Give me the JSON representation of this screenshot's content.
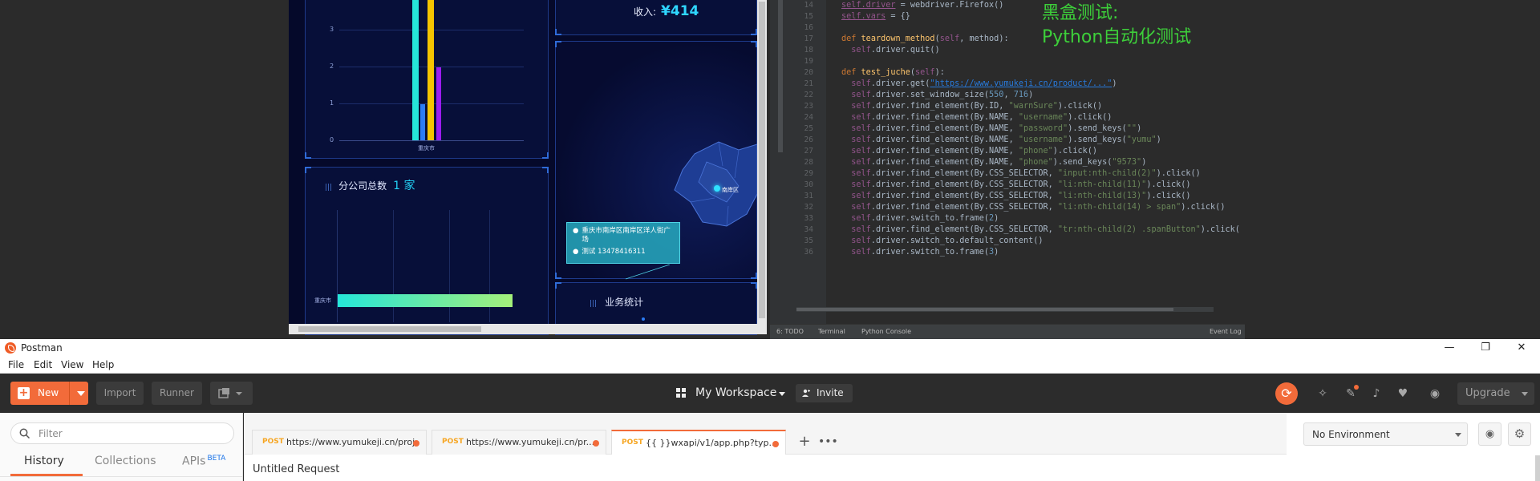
{
  "dashboard": {
    "y_ticks": [
      "3",
      "2",
      "1",
      "0"
    ],
    "x_label": "重庆市",
    "branch_title": "分公司总数",
    "branch_count": "1 家",
    "branch_bar_label": "重庆市",
    "income_label": "收入:",
    "income_value": "¥414",
    "map_marker": "南岸区",
    "tooltip_address": "重庆市南岸区南岸区洋人街广场",
    "tooltip_contact": "测试 13478416311",
    "business_title": "业务统计",
    "colors": {
      "cyan": "#25e6d9",
      "yellow": "#f5c400",
      "blue": "#2b7cf6",
      "purple": "#9b1cf0"
    }
  },
  "editor": {
    "lines": [
      {
        "n": "14",
        "code": [
          {
            "c": "selfu",
            "t": "self.driver"
          },
          {
            "c": "plain",
            "t": " = webdriver.Firefox()"
          }
        ]
      },
      {
        "n": "15",
        "code": [
          {
            "c": "selfu",
            "t": "self.vars"
          },
          {
            "c": "plain",
            "t": " = {}"
          }
        ]
      },
      {
        "n": "16",
        "code": []
      },
      {
        "n": "17",
        "code": [
          {
            "c": "kw",
            "t": "def "
          },
          {
            "c": "fn",
            "t": "teardown_method"
          },
          {
            "c": "plain",
            "t": "("
          },
          {
            "c": "self",
            "t": "self"
          },
          {
            "c": "plain",
            "t": ", method):"
          }
        ]
      },
      {
        "n": "18",
        "code": [
          {
            "c": "plain",
            "t": "  "
          },
          {
            "c": "self",
            "t": "self"
          },
          {
            "c": "plain",
            "t": ".driver.quit()"
          }
        ]
      },
      {
        "n": "19",
        "code": []
      },
      {
        "n": "20",
        "code": [
          {
            "c": "kw",
            "t": "def "
          },
          {
            "c": "fn",
            "t": "test_juche"
          },
          {
            "c": "plain",
            "t": "("
          },
          {
            "c": "self",
            "t": "self"
          },
          {
            "c": "plain",
            "t": "):"
          }
        ]
      },
      {
        "n": "21",
        "code": [
          {
            "c": "plain",
            "t": "  "
          },
          {
            "c": "self",
            "t": "self"
          },
          {
            "c": "plain",
            "t": ".driver.get("
          },
          {
            "c": "link",
            "t": "\"https://www.yumukeji.cn/product/...\""
          },
          {
            "c": "plain",
            "t": ")"
          }
        ]
      },
      {
        "n": "22",
        "code": [
          {
            "c": "plain",
            "t": "  "
          },
          {
            "c": "self",
            "t": "self"
          },
          {
            "c": "plain",
            "t": ".driver.set_window_size("
          },
          {
            "c": "num",
            "t": "550"
          },
          {
            "c": "plain",
            "t": ", "
          },
          {
            "c": "num",
            "t": "716"
          },
          {
            "c": "plain",
            "t": ")"
          }
        ]
      },
      {
        "n": "23",
        "code": [
          {
            "c": "plain",
            "t": "  "
          },
          {
            "c": "self",
            "t": "self"
          },
          {
            "c": "plain",
            "t": ".driver.find_element(By.ID, "
          },
          {
            "c": "str",
            "t": "\"warnSure\""
          },
          {
            "c": "plain",
            "t": ").click()"
          }
        ]
      },
      {
        "n": "24",
        "code": [
          {
            "c": "plain",
            "t": "  "
          },
          {
            "c": "self",
            "t": "self"
          },
          {
            "c": "plain",
            "t": ".driver.find_element(By.NAME, "
          },
          {
            "c": "str",
            "t": "\"username\""
          },
          {
            "c": "plain",
            "t": ").click()"
          }
        ]
      },
      {
        "n": "25",
        "code": [
          {
            "c": "plain",
            "t": "  "
          },
          {
            "c": "self",
            "t": "self"
          },
          {
            "c": "plain",
            "t": ".driver.find_element(By.NAME, "
          },
          {
            "c": "str",
            "t": "\"password\""
          },
          {
            "c": "plain",
            "t": ").send_keys("
          },
          {
            "c": "str",
            "t": "\"\""
          },
          {
            "c": "plain",
            "t": ")"
          }
        ]
      },
      {
        "n": "26",
        "code": [
          {
            "c": "plain",
            "t": "  "
          },
          {
            "c": "self",
            "t": "self"
          },
          {
            "c": "plain",
            "t": ".driver.find_element(By.NAME, "
          },
          {
            "c": "str",
            "t": "\"username\""
          },
          {
            "c": "plain",
            "t": ").send_keys("
          },
          {
            "c": "str",
            "t": "\"yumu\""
          },
          {
            "c": "plain",
            "t": ")"
          }
        ]
      },
      {
        "n": "27",
        "code": [
          {
            "c": "plain",
            "t": "  "
          },
          {
            "c": "self",
            "t": "self"
          },
          {
            "c": "plain",
            "t": ".driver.find_element(By.NAME, "
          },
          {
            "c": "str",
            "t": "\"phone\""
          },
          {
            "c": "plain",
            "t": ").click()"
          }
        ]
      },
      {
        "n": "28",
        "code": [
          {
            "c": "plain",
            "t": "  "
          },
          {
            "c": "self",
            "t": "self"
          },
          {
            "c": "plain",
            "t": ".driver.find_element(By.NAME, "
          },
          {
            "c": "str",
            "t": "\"phone\""
          },
          {
            "c": "plain",
            "t": ").send_keys("
          },
          {
            "c": "str",
            "t": "\"9573\""
          },
          {
            "c": "plain",
            "t": ")"
          }
        ]
      },
      {
        "n": "29",
        "code": [
          {
            "c": "plain",
            "t": "  "
          },
          {
            "c": "self",
            "t": "self"
          },
          {
            "c": "plain",
            "t": ".driver.find_element(By.CSS_SELECTOR, "
          },
          {
            "c": "str",
            "t": "\"input:nth-child(2)\""
          },
          {
            "c": "plain",
            "t": ").click()"
          }
        ]
      },
      {
        "n": "30",
        "code": [
          {
            "c": "plain",
            "t": "  "
          },
          {
            "c": "self",
            "t": "self"
          },
          {
            "c": "plain",
            "t": ".driver.find_element(By.CSS_SELECTOR, "
          },
          {
            "c": "str",
            "t": "\"li:nth-child(11)\""
          },
          {
            "c": "plain",
            "t": ").click()"
          }
        ]
      },
      {
        "n": "31",
        "code": [
          {
            "c": "plain",
            "t": "  "
          },
          {
            "c": "self",
            "t": "self"
          },
          {
            "c": "plain",
            "t": ".driver.find_element(By.CSS_SELECTOR, "
          },
          {
            "c": "str",
            "t": "\"li:nth-child(13)\""
          },
          {
            "c": "plain",
            "t": ").click()"
          }
        ]
      },
      {
        "n": "32",
        "code": [
          {
            "c": "plain",
            "t": "  "
          },
          {
            "c": "self",
            "t": "self"
          },
          {
            "c": "plain",
            "t": ".driver.find_element(By.CSS_SELECTOR, "
          },
          {
            "c": "str",
            "t": "\"li:nth-child(14) > span\""
          },
          {
            "c": "plain",
            "t": ").click()"
          }
        ]
      },
      {
        "n": "33",
        "code": [
          {
            "c": "plain",
            "t": "  "
          },
          {
            "c": "self",
            "t": "self"
          },
          {
            "c": "plain",
            "t": ".driver.switch_to.frame("
          },
          {
            "c": "num",
            "t": "2"
          },
          {
            "c": "plain",
            "t": ")"
          }
        ]
      },
      {
        "n": "34",
        "code": [
          {
            "c": "plain",
            "t": "  "
          },
          {
            "c": "self",
            "t": "self"
          },
          {
            "c": "plain",
            "t": ".driver.find_element(By.CSS_SELECTOR, "
          },
          {
            "c": "str",
            "t": "\"tr:nth-child(2) .spanButton\""
          },
          {
            "c": "plain",
            "t": ").click("
          }
        ]
      },
      {
        "n": "35",
        "code": [
          {
            "c": "plain",
            "t": "  "
          },
          {
            "c": "self",
            "t": "self"
          },
          {
            "c": "plain",
            "t": ".driver.switch_to.default_content()"
          }
        ]
      },
      {
        "n": "36",
        "code": [
          {
            "c": "plain",
            "t": "  "
          },
          {
            "c": "self",
            "t": "self"
          },
          {
            "c": "plain",
            "t": ".driver.switch_to.frame("
          },
          {
            "c": "num",
            "t": "3"
          },
          {
            "c": "plain",
            "t": ")"
          }
        ]
      }
    ],
    "overlay_line1": "黑盒测试:",
    "overlay_line2": "Python自动化测试",
    "status_todo": "6: TODO",
    "status_terminal": "Terminal",
    "status_console": "Python Console",
    "status_eventlog": "Event Log"
  },
  "postman": {
    "app_name": "Postman",
    "window_buttons": {
      "minimize": "—",
      "restore": "❐",
      "close": "✕"
    },
    "menu": [
      "File",
      "Edit",
      "View",
      "Help"
    ],
    "toolbar": {
      "new_label": "New",
      "import_label": "Import",
      "runner_label": "Runner",
      "workspace_label": "My Workspace",
      "invite_label": "Invite",
      "upgrade_label": "Upgrade"
    },
    "sidebar": {
      "filter_placeholder": "Filter",
      "tabs": [
        "History",
        "Collections",
        "APIs"
      ],
      "apis_badge": "BETA"
    },
    "request_tabs": [
      {
        "method": "POST",
        "url": "https://www.yumukeji.cn/proj..."
      },
      {
        "method": "POST",
        "url": "https://www.yumukeji.cn/pr..."
      },
      {
        "method": "POST",
        "url": "{{    }}wxapi/v1/app.php?typ..."
      }
    ],
    "environment": "No Environment",
    "request_title": "Untitled Request",
    "accent": "#f26b3a"
  }
}
